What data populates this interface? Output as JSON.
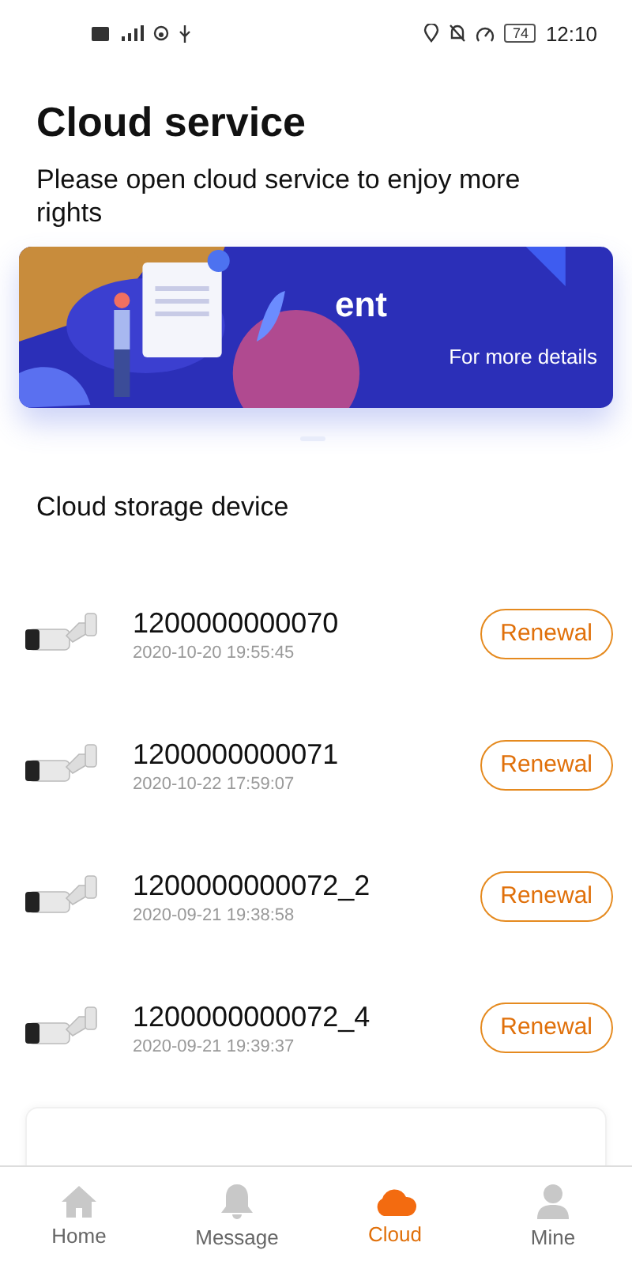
{
  "status_bar": {
    "battery": "74",
    "time": "12:10"
  },
  "title": "Cloud service",
  "subtitle": "Please open cloud service to enjoy more rights",
  "banner": {
    "kind": "picture",
    "title": "ent",
    "link": "For more details"
  },
  "section_title": "Cloud storage device",
  "devices": [
    {
      "name": "1200000000070",
      "date": "2020-10-20 19:55:45",
      "action": "Renewal"
    },
    {
      "name": "1200000000071",
      "date": "2020-10-22 17:59:07",
      "action": "Renewal"
    },
    {
      "name": "1200000000072_2",
      "date": "2020-09-21 19:38:58",
      "action": "Renewal"
    },
    {
      "name": "1200000000072_4",
      "date": "2020-09-21 19:39:37",
      "action": "Renewal"
    }
  ],
  "tabs": [
    {
      "label": "Home",
      "kind": "home",
      "selected": false
    },
    {
      "label": "Message",
      "kind": "bell",
      "selected": false
    },
    {
      "label": "Cloud",
      "kind": "cloud",
      "selected": true
    },
    {
      "label": "Mine",
      "kind": "person",
      "selected": false
    }
  ]
}
